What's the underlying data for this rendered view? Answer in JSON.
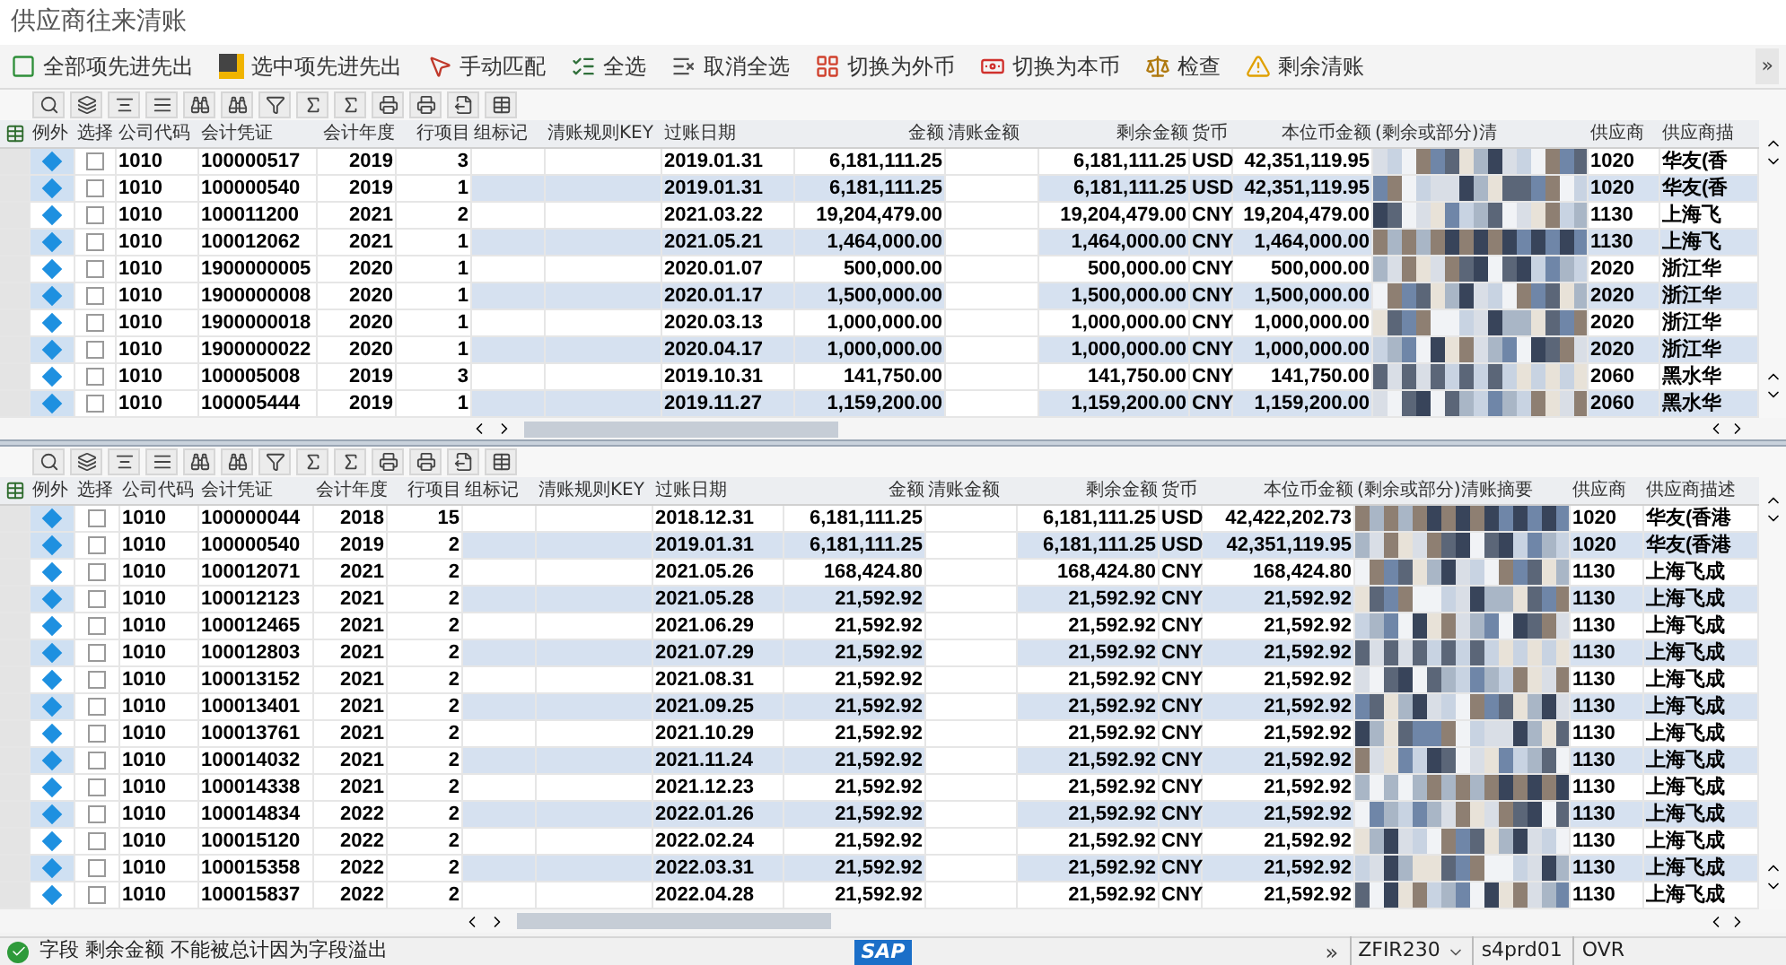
{
  "title": "供应商往来清账",
  "toolbar": [
    {
      "label": "全部项先进先出",
      "kind": "fifo_all"
    },
    {
      "label": "选中项先进先出",
      "kind": "fifo_selected"
    },
    {
      "label": "手动匹配",
      "kind": "manual"
    },
    {
      "label": "全选",
      "kind": "select_all"
    },
    {
      "label": "取消全选",
      "kind": "deselect_all"
    },
    {
      "label": "切换为外币",
      "kind": "foreign"
    },
    {
      "label": "切换为本币",
      "kind": "local"
    },
    {
      "label": "检查",
      "kind": "check"
    },
    {
      "label": "剩余清账",
      "kind": "residual"
    }
  ],
  "toolbar_overflow": "»",
  "tables": [
    {
      "columns": [
        "例外",
        "选择",
        "公司代码",
        "会计凭证",
        "会计年度",
        "行项目",
        "组标记",
        "清账规则KEY",
        "过账日期",
        "金额",
        "清账金额",
        "剩余金额",
        "货币",
        "本位币金额",
        "(剩余或部分)清",
        "供应商",
        "供应商描"
      ],
      "rows": [
        {
          "checked": false,
          "company": "1010",
          "document": "100000517",
          "year": "2019",
          "item": "3",
          "date": "2019.01.31",
          "amount": "6,181,111.25",
          "remaining": "6,181,111.25",
          "currency": "USD",
          "local_amount": "42,351,119.95",
          "vendor": "1020",
          "vendor_desc": "华友(香"
        },
        {
          "checked": false,
          "company": "1010",
          "document": "100000540",
          "year": "2019",
          "item": "1",
          "date": "2019.01.31",
          "amount": "6,181,111.25",
          "remaining": "6,181,111.25",
          "currency": "USD",
          "local_amount": "42,351,119.95",
          "vendor": "1020",
          "vendor_desc": "华友(香"
        },
        {
          "checked": false,
          "company": "1010",
          "document": "100011200",
          "year": "2021",
          "item": "2",
          "date": "2021.03.22",
          "amount": "19,204,479.00",
          "remaining": "19,204,479.00",
          "currency": "CNY",
          "local_amount": "19,204,479.00",
          "vendor": "1130",
          "vendor_desc": "上海飞"
        },
        {
          "checked": false,
          "company": "1010",
          "document": "100012062",
          "year": "2021",
          "item": "1",
          "date": "2021.05.21",
          "amount": "1,464,000.00",
          "remaining": "1,464,000.00",
          "currency": "CNY",
          "local_amount": "1,464,000.00",
          "vendor": "1130",
          "vendor_desc": "上海飞"
        },
        {
          "checked": false,
          "company": "1010",
          "document": "1900000005",
          "year": "2020",
          "item": "1",
          "date": "2020.01.07",
          "amount": "500,000.00",
          "remaining": "500,000.00",
          "currency": "CNY",
          "local_amount": "500,000.00",
          "vendor": "2020",
          "vendor_desc": "浙江华"
        },
        {
          "checked": false,
          "company": "1010",
          "document": "1900000008",
          "year": "2020",
          "item": "1",
          "date": "2020.01.17",
          "amount": "1,500,000.00",
          "remaining": "1,500,000.00",
          "currency": "CNY",
          "local_amount": "1,500,000.00",
          "vendor": "2020",
          "vendor_desc": "浙江华"
        },
        {
          "checked": false,
          "company": "1010",
          "document": "1900000018",
          "year": "2020",
          "item": "1",
          "date": "2020.03.13",
          "amount": "1,000,000.00",
          "remaining": "1,000,000.00",
          "currency": "CNY",
          "local_amount": "1,000,000.00",
          "vendor": "2020",
          "vendor_desc": "浙江华"
        },
        {
          "checked": false,
          "company": "1010",
          "document": "1900000022",
          "year": "2020",
          "item": "1",
          "date": "2020.04.17",
          "amount": "1,000,000.00",
          "remaining": "1,000,000.00",
          "currency": "CNY",
          "local_amount": "1,000,000.00",
          "vendor": "2020",
          "vendor_desc": "浙江华"
        },
        {
          "checked": false,
          "company": "1010",
          "document": "100005008",
          "year": "2019",
          "item": "3",
          "date": "2019.10.31",
          "amount": "141,750.00",
          "remaining": "141,750.00",
          "currency": "CNY",
          "local_amount": "141,750.00",
          "vendor": "2060",
          "vendor_desc": "黑水华"
        },
        {
          "checked": false,
          "company": "1010",
          "document": "100005444",
          "year": "2019",
          "item": "1",
          "date": "2019.11.27",
          "amount": "1,159,200.00",
          "remaining": "1,159,200.00",
          "currency": "CNY",
          "local_amount": "1,159,200.00",
          "vendor": "2060",
          "vendor_desc": "黑水华"
        }
      ]
    },
    {
      "columns": [
        "例外",
        "选择",
        "公司代码",
        "会计凭证",
        "会计年度",
        "行项目",
        "组标记",
        "清账规则KEY",
        "过账日期",
        "金额",
        "清账金额",
        "剩余金额",
        "货币",
        "本位币金额",
        "(剩余或部分)清账摘要",
        "供应商",
        "供应商描述"
      ],
      "rows": [
        {
          "checked": false,
          "company": "1010",
          "document": "100000044",
          "year": "2018",
          "item": "15",
          "date": "2018.12.31",
          "amount": "6,181,111.25",
          "remaining": "6,181,111.25",
          "currency": "USD",
          "local_amount": "42,422,202.73",
          "vendor": "1020",
          "vendor_desc": "华友(香港"
        },
        {
          "checked": false,
          "company": "1010",
          "document": "100000540",
          "year": "2019",
          "item": "2",
          "date": "2019.01.31",
          "amount": "6,181,111.25",
          "remaining": "6,181,111.25",
          "currency": "USD",
          "local_amount": "42,351,119.95",
          "vendor": "1020",
          "vendor_desc": "华友(香港"
        },
        {
          "checked": false,
          "company": "1010",
          "document": "100012071",
          "year": "2021",
          "item": "2",
          "date": "2021.05.26",
          "amount": "168,424.80",
          "remaining": "168,424.80",
          "currency": "CNY",
          "local_amount": "168,424.80",
          "vendor": "1130",
          "vendor_desc": "上海飞成"
        },
        {
          "checked": false,
          "company": "1010",
          "document": "100012123",
          "year": "2021",
          "item": "2",
          "date": "2021.05.28",
          "amount": "21,592.92",
          "remaining": "21,592.92",
          "currency": "CNY",
          "local_amount": "21,592.92",
          "vendor": "1130",
          "vendor_desc": "上海飞成"
        },
        {
          "checked": false,
          "company": "1010",
          "document": "100012465",
          "year": "2021",
          "item": "2",
          "date": "2021.06.29",
          "amount": "21,592.92",
          "remaining": "21,592.92",
          "currency": "CNY",
          "local_amount": "21,592.92",
          "vendor": "1130",
          "vendor_desc": "上海飞成"
        },
        {
          "checked": false,
          "company": "1010",
          "document": "100012803",
          "year": "2021",
          "item": "2",
          "date": "2021.07.29",
          "amount": "21,592.92",
          "remaining": "21,592.92",
          "currency": "CNY",
          "local_amount": "21,592.92",
          "vendor": "1130",
          "vendor_desc": "上海飞成"
        },
        {
          "checked": false,
          "company": "1010",
          "document": "100013152",
          "year": "2021",
          "item": "2",
          "date": "2021.08.31",
          "amount": "21,592.92",
          "remaining": "21,592.92",
          "currency": "CNY",
          "local_amount": "21,592.92",
          "vendor": "1130",
          "vendor_desc": "上海飞成"
        },
        {
          "checked": false,
          "company": "1010",
          "document": "100013401",
          "year": "2021",
          "item": "2",
          "date": "2021.09.25",
          "amount": "21,592.92",
          "remaining": "21,592.92",
          "currency": "CNY",
          "local_amount": "21,592.92",
          "vendor": "1130",
          "vendor_desc": "上海飞成"
        },
        {
          "checked": false,
          "company": "1010",
          "document": "100013761",
          "year": "2021",
          "item": "2",
          "date": "2021.10.29",
          "amount": "21,592.92",
          "remaining": "21,592.92",
          "currency": "CNY",
          "local_amount": "21,592.92",
          "vendor": "1130",
          "vendor_desc": "上海飞成"
        },
        {
          "checked": false,
          "company": "1010",
          "document": "100014032",
          "year": "2021",
          "item": "2",
          "date": "2021.11.24",
          "amount": "21,592.92",
          "remaining": "21,592.92",
          "currency": "CNY",
          "local_amount": "21,592.92",
          "vendor": "1130",
          "vendor_desc": "上海飞成"
        },
        {
          "checked": false,
          "company": "1010",
          "document": "100014338",
          "year": "2021",
          "item": "2",
          "date": "2021.12.23",
          "amount": "21,592.92",
          "remaining": "21,592.92",
          "currency": "CNY",
          "local_amount": "21,592.92",
          "vendor": "1130",
          "vendor_desc": "上海飞成"
        },
        {
          "checked": false,
          "company": "1010",
          "document": "100014834",
          "year": "2022",
          "item": "2",
          "date": "2022.01.26",
          "amount": "21,592.92",
          "remaining": "21,592.92",
          "currency": "CNY",
          "local_amount": "21,592.92",
          "vendor": "1130",
          "vendor_desc": "上海飞成"
        },
        {
          "checked": false,
          "company": "1010",
          "document": "100015120",
          "year": "2022",
          "item": "2",
          "date": "2022.02.24",
          "amount": "21,592.92",
          "remaining": "21,592.92",
          "currency": "CNY",
          "local_amount": "21,592.92",
          "vendor": "1130",
          "vendor_desc": "上海飞成"
        },
        {
          "checked": false,
          "company": "1010",
          "document": "100015358",
          "year": "2022",
          "item": "2",
          "date": "2022.03.31",
          "amount": "21,592.92",
          "remaining": "21,592.92",
          "currency": "CNY",
          "local_amount": "21,592.92",
          "vendor": "1130",
          "vendor_desc": "上海飞成"
        },
        {
          "checked": false,
          "company": "1010",
          "document": "100015837",
          "year": "2022",
          "item": "2",
          "date": "2022.04.28",
          "amount": "21,592.92",
          "remaining": "21,592.92",
          "currency": "CNY",
          "local_amount": "21,592.92",
          "vendor": "1130",
          "vendor_desc": "上海飞成"
        }
      ]
    }
  ],
  "status_bar": {
    "kind": "success",
    "message": "字段 剩余金额 不能被总计因为字段溢出",
    "logo": "SAP",
    "overflow": "»",
    "transaction": "ZFIR230",
    "server": "s4prd01",
    "mode": "OVR"
  }
}
